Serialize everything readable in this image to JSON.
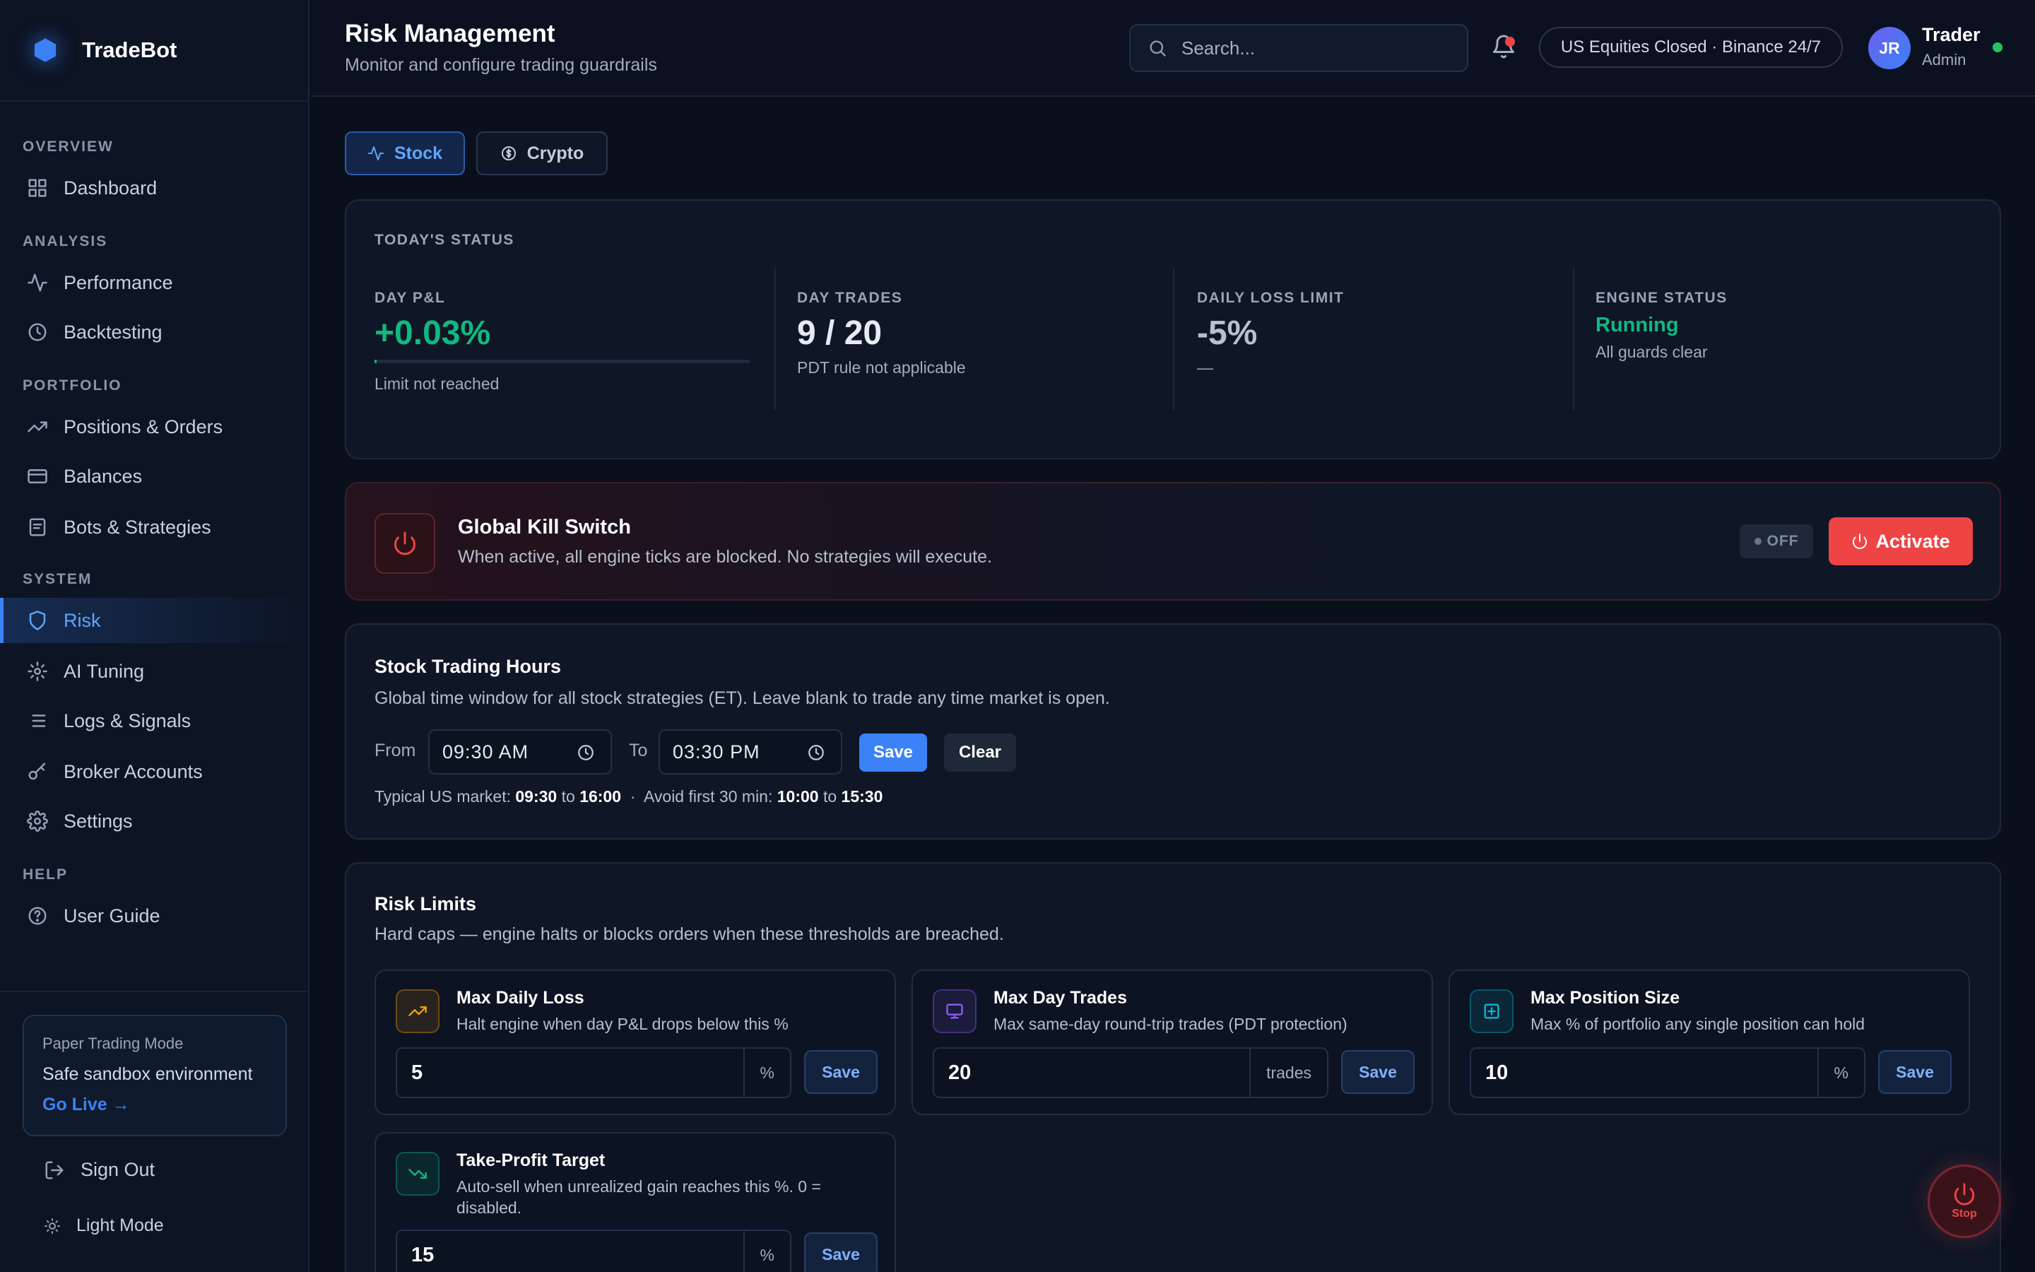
{
  "brand": {
    "name": "TradeBot"
  },
  "sidebar": {
    "sections": [
      "OVERVIEW",
      "ANALYSIS",
      "PORTFOLIO",
      "SYSTEM",
      "HELP"
    ],
    "items": [
      {
        "label": "Dashboard",
        "icon": "grid-icon"
      },
      {
        "label": "Performance",
        "icon": "activity-icon"
      },
      {
        "label": "Backtesting",
        "icon": "clock-icon"
      },
      {
        "label": "Positions & Orders",
        "icon": "trending-up-icon"
      },
      {
        "label": "Balances",
        "icon": "credit-card-icon"
      },
      {
        "label": "Bots & Strategies",
        "icon": "file-icon"
      },
      {
        "label": "Risk",
        "icon": "shield-icon",
        "active": true
      },
      {
        "label": "AI Tuning",
        "icon": "sparkle-icon"
      },
      {
        "label": "Logs & Signals",
        "icon": "list-icon"
      },
      {
        "label": "Broker Accounts",
        "icon": "key-icon"
      },
      {
        "label": "Settings",
        "icon": "gear-icon"
      },
      {
        "label": "User Guide",
        "icon": "help-circle-icon"
      }
    ],
    "paper": {
      "title": "Paper Trading Mode",
      "subtitle": "Safe sandbox environment",
      "link": "Go Live →"
    },
    "sign_out": "Sign Out",
    "light_mode": "Light Mode"
  },
  "header": {
    "title": "Risk Management",
    "subtitle": "Monitor and configure trading guardrails",
    "search_placeholder": "Search...",
    "market_status": "US Equities Closed · Binance 24/7",
    "user": {
      "initials": "JR",
      "name": "Trader",
      "role": "Admin"
    }
  },
  "tabs": [
    {
      "label": "Stock",
      "active": true
    },
    {
      "label": "Crypto"
    }
  ],
  "status": {
    "title": "TODAY'S STATUS",
    "day_pnl": {
      "label": "DAY P&L",
      "value": "+0.03%",
      "sub": "Limit not reached",
      "progress": 0.006
    },
    "day_trades": {
      "label": "DAY TRADES",
      "value": "9 / 20",
      "sub": "PDT rule not applicable"
    },
    "daily_loss": {
      "label": "DAILY LOSS LIMIT",
      "value": "-5%",
      "sub": "—"
    },
    "engine": {
      "label": "ENGINE STATUS",
      "value": "Running",
      "sub": "All guards clear"
    }
  },
  "kill_switch": {
    "title": "Global Kill Switch",
    "subtitle": "When active, all engine ticks are blocked. No strategies will execute.",
    "state": "OFF",
    "button": "Activate"
  },
  "hours": {
    "title": "Stock Trading Hours",
    "subtitle": "Global time window for all stock strategies (ET). Leave blank to trade any time market is open.",
    "from_label": "From",
    "from_value": "09:30 AM",
    "to_label": "To",
    "to_value": "03:30 PM",
    "save": "Save",
    "clear": "Clear",
    "typical": {
      "prefix": "Typical US market:",
      "open": "09:30",
      "to1": "to",
      "close": "16:00",
      "sep": "·",
      "avoid": "Avoid first 30 min:",
      "a_open": "10:00",
      "to2": "to",
      "a_close": "15:30"
    }
  },
  "limits": {
    "title": "Risk Limits",
    "subtitle": "Hard caps — engine halts or blocks orders when these thresholds are breached.",
    "items": [
      {
        "title": "Max Daily Loss",
        "desc": "Halt engine when day P&L drops below this %",
        "value": "5",
        "unit": "%",
        "save": "Save",
        "color": "#f59e0b"
      },
      {
        "title": "Max Day Trades",
        "desc": "Max same-day round-trip trades (PDT protection)",
        "value": "20",
        "unit": "trades",
        "save": "Save",
        "color": "#8b5cf6"
      },
      {
        "title": "Max Position Size",
        "desc": "Max % of portfolio any single position can hold",
        "value": "10",
        "unit": "%",
        "save": "Save",
        "color": "#06b6d4"
      },
      {
        "title": "Take-Profit Target",
        "desc": "Auto-sell when unrealized gain reaches this %. 0 = disabled.",
        "value": "15",
        "unit": "%",
        "save": "Save",
        "color": "#10b981"
      }
    ]
  },
  "stop_fab": {
    "label": "Stop"
  },
  "colors": {
    "accent": "#3b82f6",
    "positive": "#10b981",
    "danger": "#ef4444",
    "bg": "#0a0f1c"
  }
}
